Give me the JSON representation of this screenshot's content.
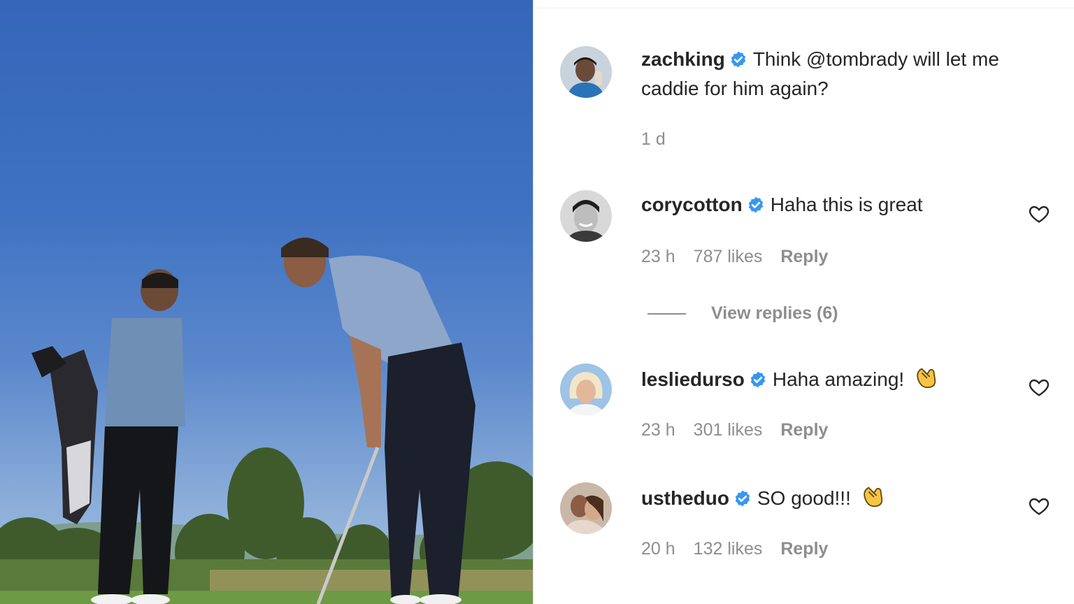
{
  "post": {
    "author": "zachking",
    "caption_line1": "Think @tombrady will let me",
    "caption_line2": "caddie for him again?",
    "age": "1 d"
  },
  "comments": [
    {
      "username": "corycotton",
      "text": "Haha this is great",
      "emoji": "",
      "age": "23 h",
      "likes": "787 likes",
      "reply": "Reply"
    },
    {
      "username": "lesliedurso",
      "text": "Haha amazing!",
      "emoji": "clapping-hands",
      "age": "23 h",
      "likes": "301 likes",
      "reply": "Reply"
    },
    {
      "username": "ustheduo",
      "text": "SO good!!!",
      "emoji": "clapping-hands",
      "age": "20 h",
      "likes": "132 likes",
      "reply": "Reply"
    }
  ],
  "view_replies": "View replies (6)",
  "icons": {
    "verified": "verified-badge-icon",
    "like": "heart-icon",
    "emoji": "clapping-hands-icon"
  },
  "colors": {
    "verified_blue": "#3897f0",
    "text": "#262626",
    "secondary_text": "#8e8e8e"
  }
}
